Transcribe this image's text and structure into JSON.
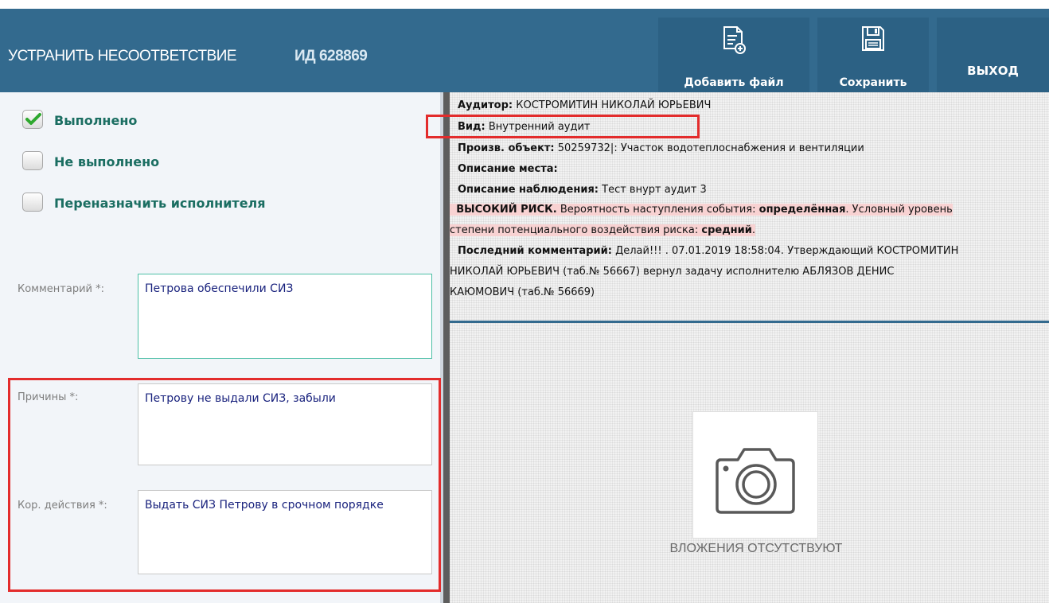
{
  "header": {
    "title": "УСТРАНИТЬ НЕСООТВЕТСТВИЕ",
    "id_label": "ИД 628869",
    "add_file": "Добавить файл",
    "save": "Сохранить",
    "exit": "ВЫХОД"
  },
  "status_options": [
    {
      "label": "Выполнено",
      "checked": true
    },
    {
      "label": "Не выполнено",
      "checked": false
    },
    {
      "label": "Переназначить исполнителя",
      "checked": false
    }
  ],
  "form": {
    "comment_label": "Комментарий *:",
    "comment_value": "Петрова обеспечили СИЗ",
    "reasons_label": "Причины *:",
    "reasons_value": "Петрову не выдали СИЗ, забыли",
    "actions_label": "Кор. действия *:",
    "actions_value": "Выдать СИЗ Петрову в срочном порядке"
  },
  "info": {
    "auditor_label": "Аудитор:",
    "auditor_value": "КОСТРОМИТИН НИКОЛАЙ ЮРЬЕВИЧ",
    "kind_label": "Вид:",
    "kind_value": "Внутренний аудит",
    "object_label": "Произв. объект:",
    "object_value": "50259732|: Участок водотеплоснабжения и вентиляции",
    "place_label": "Описание места:",
    "observation_label": "Описание наблюдения:",
    "observation_value": "Тест внурт аудит 3",
    "risk_label": "ВЫСОКИЙ РИСК.",
    "risk_text1": "Вероятность наступления события:",
    "risk_probability": "определённая",
    "risk_text2": ". Условный уровень",
    "risk_text3": "степени потенциального воздействия риска:",
    "risk_level": "средний",
    "comment_label": "Последний комментарий:",
    "comment_line1": "Делай!!! . 07.01.2019 18:58:04. Утверждающий КОСТРОМИТИН",
    "comment_line2": "НИКОЛАЙ ЮРЬЕВИЧ (таб.№ 56667) вернул задачу исполнителю АБЛЯЗОВ ДЕНИС",
    "comment_line3": "КАЮМОВИЧ (таб.№ 56669)"
  },
  "attachments": {
    "empty_text": "ВЛОЖЕНИЯ ОТСУТСТВУЮТ"
  },
  "colors": {
    "header_bg": "#336a8e",
    "button_bg": "#2c6184",
    "accent_green": "#1b6e62",
    "annotation_red": "#e32c2c",
    "risk_highlight": "#f8d2d2"
  },
  "icons": [
    "add-file-icon",
    "save-disk-icon",
    "checkmark-icon",
    "camera-icon"
  ]
}
